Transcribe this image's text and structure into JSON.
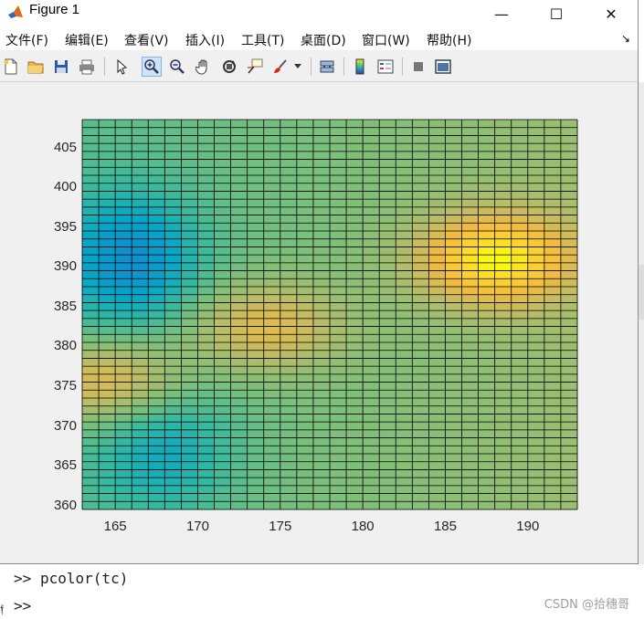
{
  "window": {
    "title": "Figure 1"
  },
  "window_controls": {
    "minimize": "—",
    "maximize": "☐",
    "close": "✕"
  },
  "menu": {
    "items": [
      "文件(F)",
      "编辑(E)",
      "查看(V)",
      "插入(I)",
      "工具(T)",
      "桌面(D)",
      "窗口(W)",
      "帮助(H)"
    ],
    "corner": "↘"
  },
  "toolbar": {
    "tools": [
      "new-figure-icon",
      "open-folder-icon",
      "save-icon",
      "print-icon",
      "edit-plot-icon",
      "zoom-in-icon",
      "zoom-out-icon",
      "pan-icon",
      "rotate-3d-icon",
      "data-cursor-icon",
      "brush-icon",
      "link-plot-icon",
      "colorbar-icon",
      "legend-icon",
      "hide-tools-icon",
      "show-tools-icon"
    ],
    "active_tool": "zoom-in-icon"
  },
  "chart_data": {
    "type": "heatmap",
    "title": "",
    "xlabel": "",
    "ylabel": "",
    "xlim": [
      163,
      193
    ],
    "ylim": [
      359.5,
      408.5
    ],
    "xticks": [
      "165",
      "170",
      "175",
      "180",
      "185",
      "190"
    ],
    "xtick_values": [
      165,
      170,
      175,
      180,
      185,
      190
    ],
    "yticks": [
      "360",
      "365",
      "370",
      "375",
      "380",
      "385",
      "390",
      "395",
      "400",
      "405"
    ],
    "ytick_values": [
      360,
      365,
      370,
      375,
      380,
      385,
      390,
      395,
      400,
      405
    ],
    "grid_cols": 30,
    "grid_rows": 49,
    "colormap": "parula",
    "grid_color": "#000000",
    "hotspots": [
      {
        "x": 188,
        "y": 391,
        "value": 0.92
      },
      {
        "x": 174,
        "y": 382.5,
        "value": 0.78
      },
      {
        "x": 164.5,
        "y": 375.5,
        "value": 0.82
      }
    ],
    "lowspots": [
      {
        "x": 166,
        "y": 391,
        "value": 0.35
      },
      {
        "x": 168,
        "y": 367,
        "value": 0.45
      }
    ]
  },
  "console": {
    "lines": [
      {
        "prompt": ">>",
        "command": "pcolor(tc)"
      },
      {
        "prompt": ">>",
        "command": ""
      }
    ],
    "gutter": "𝔣"
  },
  "watermark": "CSDN @拾穗哥"
}
